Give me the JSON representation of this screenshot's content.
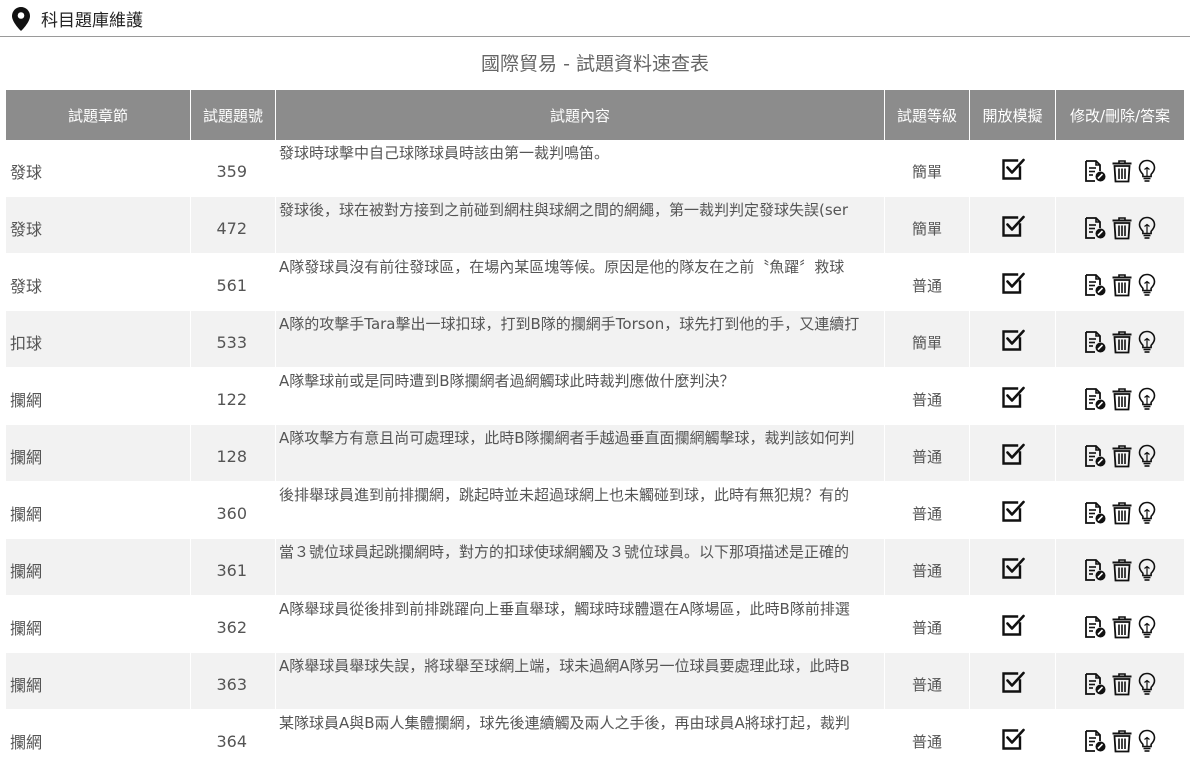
{
  "header": {
    "page_title": "科目題庫維護",
    "icon": "map-pin-icon"
  },
  "table_title": "國際貿易 - 試題資料速查表",
  "columns": [
    "試題章節",
    "試題題號",
    "試題內容",
    "試題等級",
    "開放模擬",
    "修改/刪除/答案"
  ],
  "rows": [
    {
      "chapter": "發球",
      "number": "359",
      "content": "發球時球擊中自己球隊球員時該由第一裁判鳴笛。",
      "level": "簡單",
      "open": true
    },
    {
      "chapter": "發球",
      "number": "472",
      "content": "發球後，球在被對方接到之前碰到網柱與球網之間的網繩，第一裁判判定發球失誤(ser",
      "level": "簡單",
      "open": true
    },
    {
      "chapter": "發球",
      "number": "561",
      "content": "A隊發球員沒有前往發球區，在場內某區塊等候。原因是他的隊友在之前〝魚躍〞救球",
      "level": "普通",
      "open": true
    },
    {
      "chapter": "扣球",
      "number": "533",
      "content": "A隊的攻擊手Tara擊出一球扣球，打到B隊的攔網手Torson，球先打到他的手，又連續打",
      "level": "簡單",
      "open": true
    },
    {
      "chapter": "攔網",
      "number": "122",
      "content": "A隊擊球前或是同時遭到B隊攔網者過網觸球此時裁判應做什麼判決？",
      "level": "普通",
      "open": true
    },
    {
      "chapter": "攔網",
      "number": "128",
      "content": "A隊攻擊方有意且尚可處理球，此時B隊攔網者手越過垂直面攔網觸擊球，裁判該如何判",
      "level": "普通",
      "open": true
    },
    {
      "chapter": "攔網",
      "number": "360",
      "content": "後排舉球員進到前排攔網，跳起時並未超過球網上也未觸碰到球，此時有無犯規？有的",
      "level": "普通",
      "open": true
    },
    {
      "chapter": "攔網",
      "number": "361",
      "content": "當３號位球員起跳攔網時，對方的扣球使球網觸及３號位球員。以下那項描述是正確的",
      "level": "普通",
      "open": true
    },
    {
      "chapter": "攔網",
      "number": "362",
      "content": "A隊舉球員從後排到前排跳躍向上垂直舉球，觸球時球體還在A隊場區，此時B隊前排選",
      "level": "普通",
      "open": true
    },
    {
      "chapter": "攔網",
      "number": "363",
      "content": "A隊舉球員舉球失誤，將球舉至球網上端，球未過網A隊另一位球員要處理此球，此時B",
      "level": "普通",
      "open": true
    },
    {
      "chapter": "攔網",
      "number": "364",
      "content": "某隊球員A與B兩人集體攔網，球先後連續觸及兩人之手後，再由球員A將球打起，裁判",
      "level": "普通",
      "open": true
    }
  ],
  "action_icons": [
    "edit-document-icon",
    "trash-icon",
    "lightbulb-answer-icon"
  ],
  "colors": {
    "header_bg": "#8c8c8c",
    "row_alt_bg": "#f2f2f2",
    "text": "#555555"
  }
}
